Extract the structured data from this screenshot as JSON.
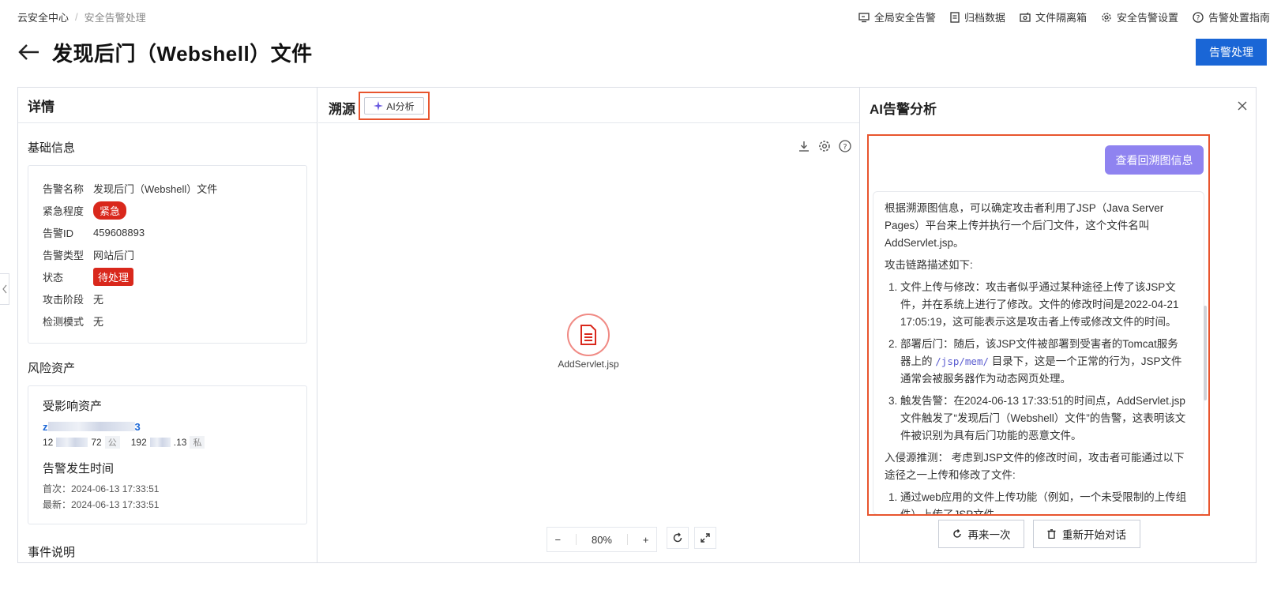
{
  "breadcrumb": {
    "root": "云安全中心",
    "separator": "/",
    "current": "安全告警处理"
  },
  "topnav": [
    {
      "label": "全局安全告警",
      "icon": "monitor-icon"
    },
    {
      "label": "归档数据",
      "icon": "archive-icon"
    },
    {
      "label": "文件隔离箱",
      "icon": "box-icon"
    },
    {
      "label": "安全告警设置",
      "icon": "gear-icon"
    },
    {
      "label": "告警处置指南",
      "icon": "help-icon"
    }
  ],
  "page": {
    "title": "发现后门（Webshell）文件",
    "action_label": "告警处理"
  },
  "details": {
    "header": "详情",
    "basic_section": "基础信息",
    "rows": [
      {
        "key": "告警名称",
        "value": "发现后门（Webshell）文件"
      },
      {
        "key": "紧急程度",
        "value": "紧急"
      },
      {
        "key": "告警ID",
        "value": "459608893"
      },
      {
        "key": "告警类型",
        "value": "网站后门"
      },
      {
        "key": "状态",
        "value": "待处理"
      },
      {
        "key": "攻击阶段",
        "value": "无"
      },
      {
        "key": "检测模式",
        "value": "无"
      }
    ],
    "risk_section": "风险资产",
    "affected_assets": "受影响资产",
    "asset_name_start": "z",
    "asset_name_end": "3",
    "ip_public_start": "12",
    "ip_public_end": "72",
    "ip_public_tag": "公",
    "ip_private_start": "192",
    "ip_private_end": ".13",
    "ip_private_tag": "私",
    "time_section": "告警发生时间",
    "first_seen": "首次：2024-06-13 17:33:51",
    "last_seen": "最新：2024-06-13 17:33:51",
    "event_section": "事件说明"
  },
  "trace": {
    "header": "溯源",
    "ai_button": "AI分析",
    "node_label": "AddServlet.jsp",
    "zoom": "80%",
    "zoom_minus": "−",
    "zoom_plus": "+"
  },
  "ai_panel": {
    "header": "AI告警分析",
    "query_button": "查看回溯图信息",
    "intro": "根据溯源图信息，可以确定攻击者利用了JSP（Java Server Pages）平台来上传并执行一个后门文件，这个文件名叫AddServlet.jsp。",
    "chain_title": "攻击链路描述如下:",
    "steps": [
      {
        "text": "文件上传与修改：攻击者似乎通过某种途径上传了该JSP文件，并在系统上进行了修改。文件的修改时间是2022-04-21 17:05:19，这可能表示这是攻击者上传或修改文件的时间。"
      },
      {
        "before": "部署后门：随后，该JSP文件被部署到受害者的Tomcat服务器上的",
        "code": "/jsp/mem/",
        "after": "目录下，这是一个正常的行为，JSP文件通常会被服务器作为动态网页处理。"
      },
      {
        "text": "触发告警：在2024-06-13 17:33:51的时间点，AddServlet.jsp文件触发了“发现后门（Webshell）文件”的告警，这表明该文件被识别为具有后门功能的恶意文件。"
      }
    ],
    "inference": "入侵源推测： 考虑到JSP文件的修改时间，攻击者可能通过以下途径之一上传和修改了文件:",
    "inference_steps": [
      {
        "text": "通过web应用的文件上传功能（例如，一个未受限制的上传组件）上传了JSP文件。"
      }
    ],
    "retry_button": "再来一次",
    "restart_button": "重新开始对话"
  }
}
